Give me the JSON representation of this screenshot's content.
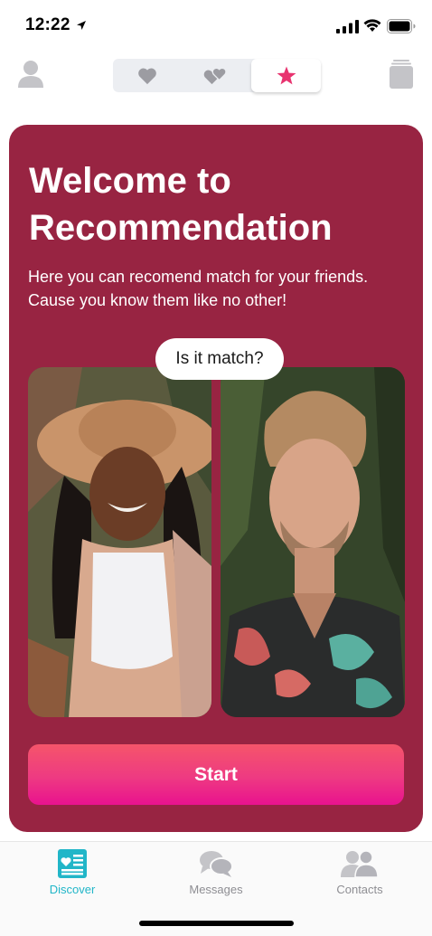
{
  "status_bar": {
    "time": "12:22",
    "icons": [
      "location-arrow-icon",
      "signal-icon",
      "wifi-icon",
      "battery-icon"
    ]
  },
  "top_nav": {
    "left_icon": "profile-icon",
    "segments": [
      {
        "icon": "heart-icon",
        "selected": false
      },
      {
        "icon": "double-heart-icon",
        "selected": false
      },
      {
        "icon": "star-icon",
        "selected": true
      }
    ],
    "right_icon": "card-stack-icon"
  },
  "card": {
    "title": "Welcome to Recommendation",
    "subtitle": "Here you can recomend match for your friends. Cause you know them like no other!",
    "bubble": "Is it match?",
    "start_label": "Start",
    "background": "#982442"
  },
  "tab_bar": {
    "tabs": [
      {
        "label": "Discover",
        "icon": "discover-icon",
        "active": true
      },
      {
        "label": "Messages",
        "icon": "chat-bubbles-icon",
        "active": false
      },
      {
        "label": "Contacts",
        "icon": "contacts-icon",
        "active": false
      }
    ],
    "active_color": "#21b6c8",
    "inactive_color": "#8e8e93"
  },
  "colors": {
    "accent_pink": "#ee3a82",
    "star": "#e8336f"
  }
}
